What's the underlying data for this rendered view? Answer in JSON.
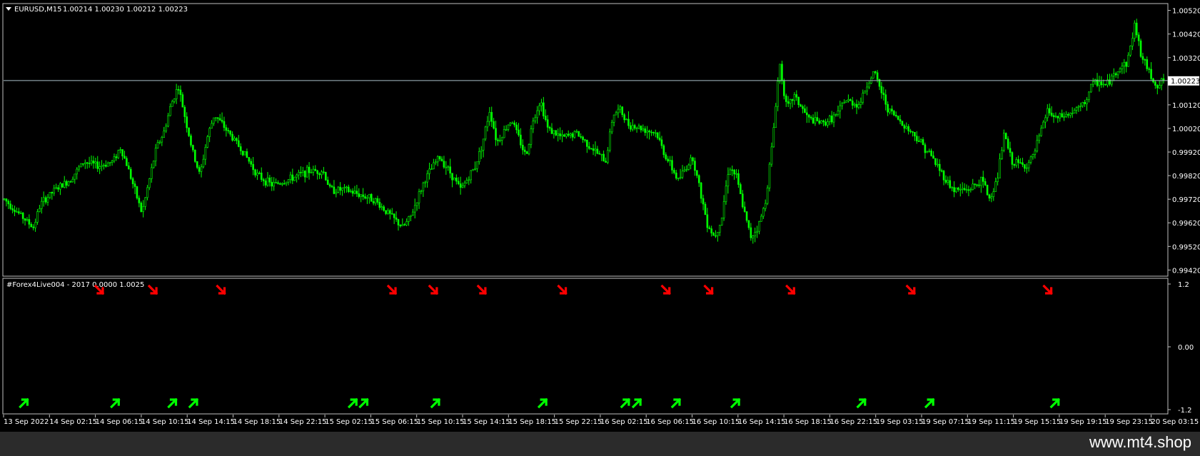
{
  "main_chart": {
    "symbol_label": "EURUSD,M15",
    "ohlc": "1.00214 1.00230 1.00212 1.00223",
    "current_price": "1.00223",
    "price_scale": [
      "1.00520",
      "1.00420",
      "1.00320",
      "1.00223",
      "1.00120",
      "1.00020",
      "0.99920",
      "0.99820",
      "0.99720",
      "0.99620",
      "0.99520",
      "0.99420"
    ],
    "price_range": [
      0.994,
      1.0054
    ],
    "price_path": [
      [
        0,
        0.9972
      ],
      [
        2,
        0.9966
      ],
      [
        4,
        0.996
      ],
      [
        5,
        0.997
      ],
      [
        7,
        0.9976
      ],
      [
        9,
        0.998
      ],
      [
        11,
        0.9988
      ],
      [
        13,
        0.9986
      ],
      [
        15,
        0.9988
      ],
      [
        16,
        0.9994
      ],
      [
        17,
        0.9986
      ],
      [
        18,
        0.9976
      ],
      [
        19,
        0.9966
      ],
      [
        20,
        0.998
      ],
      [
        21,
        0.9994
      ],
      [
        22,
        1.0
      ],
      [
        23,
        1.0012
      ],
      [
        24,
        1.002
      ],
      [
        25,
        1.0006
      ],
      [
        26,
        0.9992
      ],
      [
        27,
        0.9982
      ],
      [
        28,
        0.9998
      ],
      [
        29,
        1.0008
      ],
      [
        31,
        1.0
      ],
      [
        33,
        0.9992
      ],
      [
        35,
        0.9982
      ],
      [
        37,
        0.9978
      ],
      [
        39,
        0.998
      ],
      [
        42,
        0.9984
      ],
      [
        44,
        0.9984
      ],
      [
        45,
        0.9976
      ],
      [
        47,
        0.9976
      ],
      [
        49,
        0.9974
      ],
      [
        51,
        0.9972
      ],
      [
        53,
        0.9966
      ],
      [
        55,
        0.996
      ],
      [
        56,
        0.9964
      ],
      [
        58,
        0.998
      ],
      [
        60,
        0.999
      ],
      [
        61,
        0.9986
      ],
      [
        63,
        0.9976
      ],
      [
        65,
        0.9986
      ],
      [
        66,
        0.9996
      ],
      [
        67,
        1.001
      ],
      [
        68,
        0.9996
      ],
      [
        70,
        1.0006
      ],
      [
        72,
        0.999
      ],
      [
        73,
        1.0006
      ],
      [
        74,
        1.0014
      ],
      [
        75,
        1.0002
      ],
      [
        77,
        0.9998
      ],
      [
        79,
        1.0
      ],
      [
        81,
        0.9994
      ],
      [
        83,
        0.9988
      ],
      [
        84,
        1.0008
      ],
      [
        85,
        1.001
      ],
      [
        86,
        1.0004
      ],
      [
        88,
        1.0002
      ],
      [
        90,
        1.0
      ],
      [
        91,
        0.9992
      ],
      [
        93,
        0.998
      ],
      [
        95,
        0.999
      ],
      [
        96,
        0.9976
      ],
      [
        97,
        0.9962
      ],
      [
        98,
        0.9956
      ],
      [
        99,
        0.9964
      ],
      [
        100,
        0.9986
      ],
      [
        101,
        0.9982
      ],
      [
        102,
        0.9968
      ],
      [
        103,
        0.9956
      ],
      [
        104,
        0.996
      ],
      [
        105,
        0.997
      ],
      [
        106,
        0.9996
      ],
      [
        107,
        1.003
      ],
      [
        108,
        1.001
      ],
      [
        109,
        1.0016
      ],
      [
        111,
        1.0006
      ],
      [
        113,
        1.0004
      ],
      [
        115,
        1.0008
      ],
      [
        116,
        1.0014
      ],
      [
        118,
        1.0012
      ],
      [
        119,
        1.002
      ],
      [
        120,
        1.0026
      ],
      [
        122,
        1.001
      ],
      [
        124,
        1.0004
      ],
      [
        126,
        0.9998
      ],
      [
        128,
        0.999
      ],
      [
        130,
        0.998
      ],
      [
        131,
        0.9976
      ],
      [
        133,
        0.9976
      ],
      [
        135,
        0.998
      ],
      [
        136,
        0.9972
      ],
      [
        137,
        0.998
      ],
      [
        138,
        1.0
      ],
      [
        139,
        0.9988
      ],
      [
        141,
        0.9986
      ],
      [
        142,
        0.999
      ],
      [
        143,
        1.0
      ],
      [
        144,
        1.001
      ],
      [
        145,
        1.0006
      ],
      [
        147,
        1.0008
      ],
      [
        149,
        1.0012
      ],
      [
        150,
        1.002
      ],
      [
        151,
        1.0022
      ],
      [
        152,
        1.002
      ],
      [
        153,
        1.0024
      ],
      [
        154,
        1.0028
      ],
      [
        155,
        1.003
      ],
      [
        156,
        1.0046
      ],
      [
        157,
        1.0032
      ],
      [
        158,
        1.0026
      ],
      [
        159,
        1.002
      ],
      [
        160,
        1.00223
      ]
    ],
    "price_path_x_range": [
      0,
      160
    ]
  },
  "time_axis": [
    "13 Sep 2022",
    "14 Sep 02:15",
    "14 Sep 06:15",
    "14 Sep 10:15",
    "14 Sep 14:15",
    "14 Sep 18:15",
    "14 Sep 22:15",
    "15 Sep 02:15",
    "15 Sep 06:15",
    "15 Sep 10:15",
    "15 Sep 14:15",
    "15 Sep 18:15",
    "15 Sep 22:15",
    "16 Sep 02:15",
    "16 Sep 06:15",
    "16 Sep 10:15",
    "16 Sep 14:15",
    "16 Sep 18:15",
    "16 Sep 22:15",
    "19 Sep 03:15",
    "19 Sep 07:15",
    "19 Sep 11:15",
    "19 Sep 15:15",
    "19 Sep 19:15",
    "19 Sep 23:15",
    "20 Sep 03:15"
  ],
  "indicator": {
    "label": "#Forex4Live004 - 2017 0.0000 1.0025",
    "scale": [
      "1.2",
      "0.00",
      "-1.2"
    ],
    "sell_signals": [
      13.2,
      20.6,
      30.0,
      53.6,
      59.3,
      66.0,
      77.1,
      91.4,
      97.3,
      108.6,
      125.2,
      144.1
    ],
    "buy_signals": [
      2.8,
      15.4,
      23.3,
      26.2,
      48.2,
      49.7,
      59.6,
      74.4,
      85.8,
      87.4,
      92.8,
      101.0,
      118.4,
      127.8,
      145.1
    ],
    "colors": {
      "sell": "#ff0000",
      "buy": "#00ff00"
    }
  },
  "colors": {
    "candle": "#00ff00",
    "background": "#000000",
    "text": "#ffffff",
    "price_line": "#a9c0c9",
    "frame": "#c0c0c0"
  },
  "icons": {
    "dropdown": "triangle-down-icon",
    "sell": "arrow-down-right-icon",
    "buy": "arrow-up-right-icon"
  },
  "watermark": "www.mt4.shop"
}
